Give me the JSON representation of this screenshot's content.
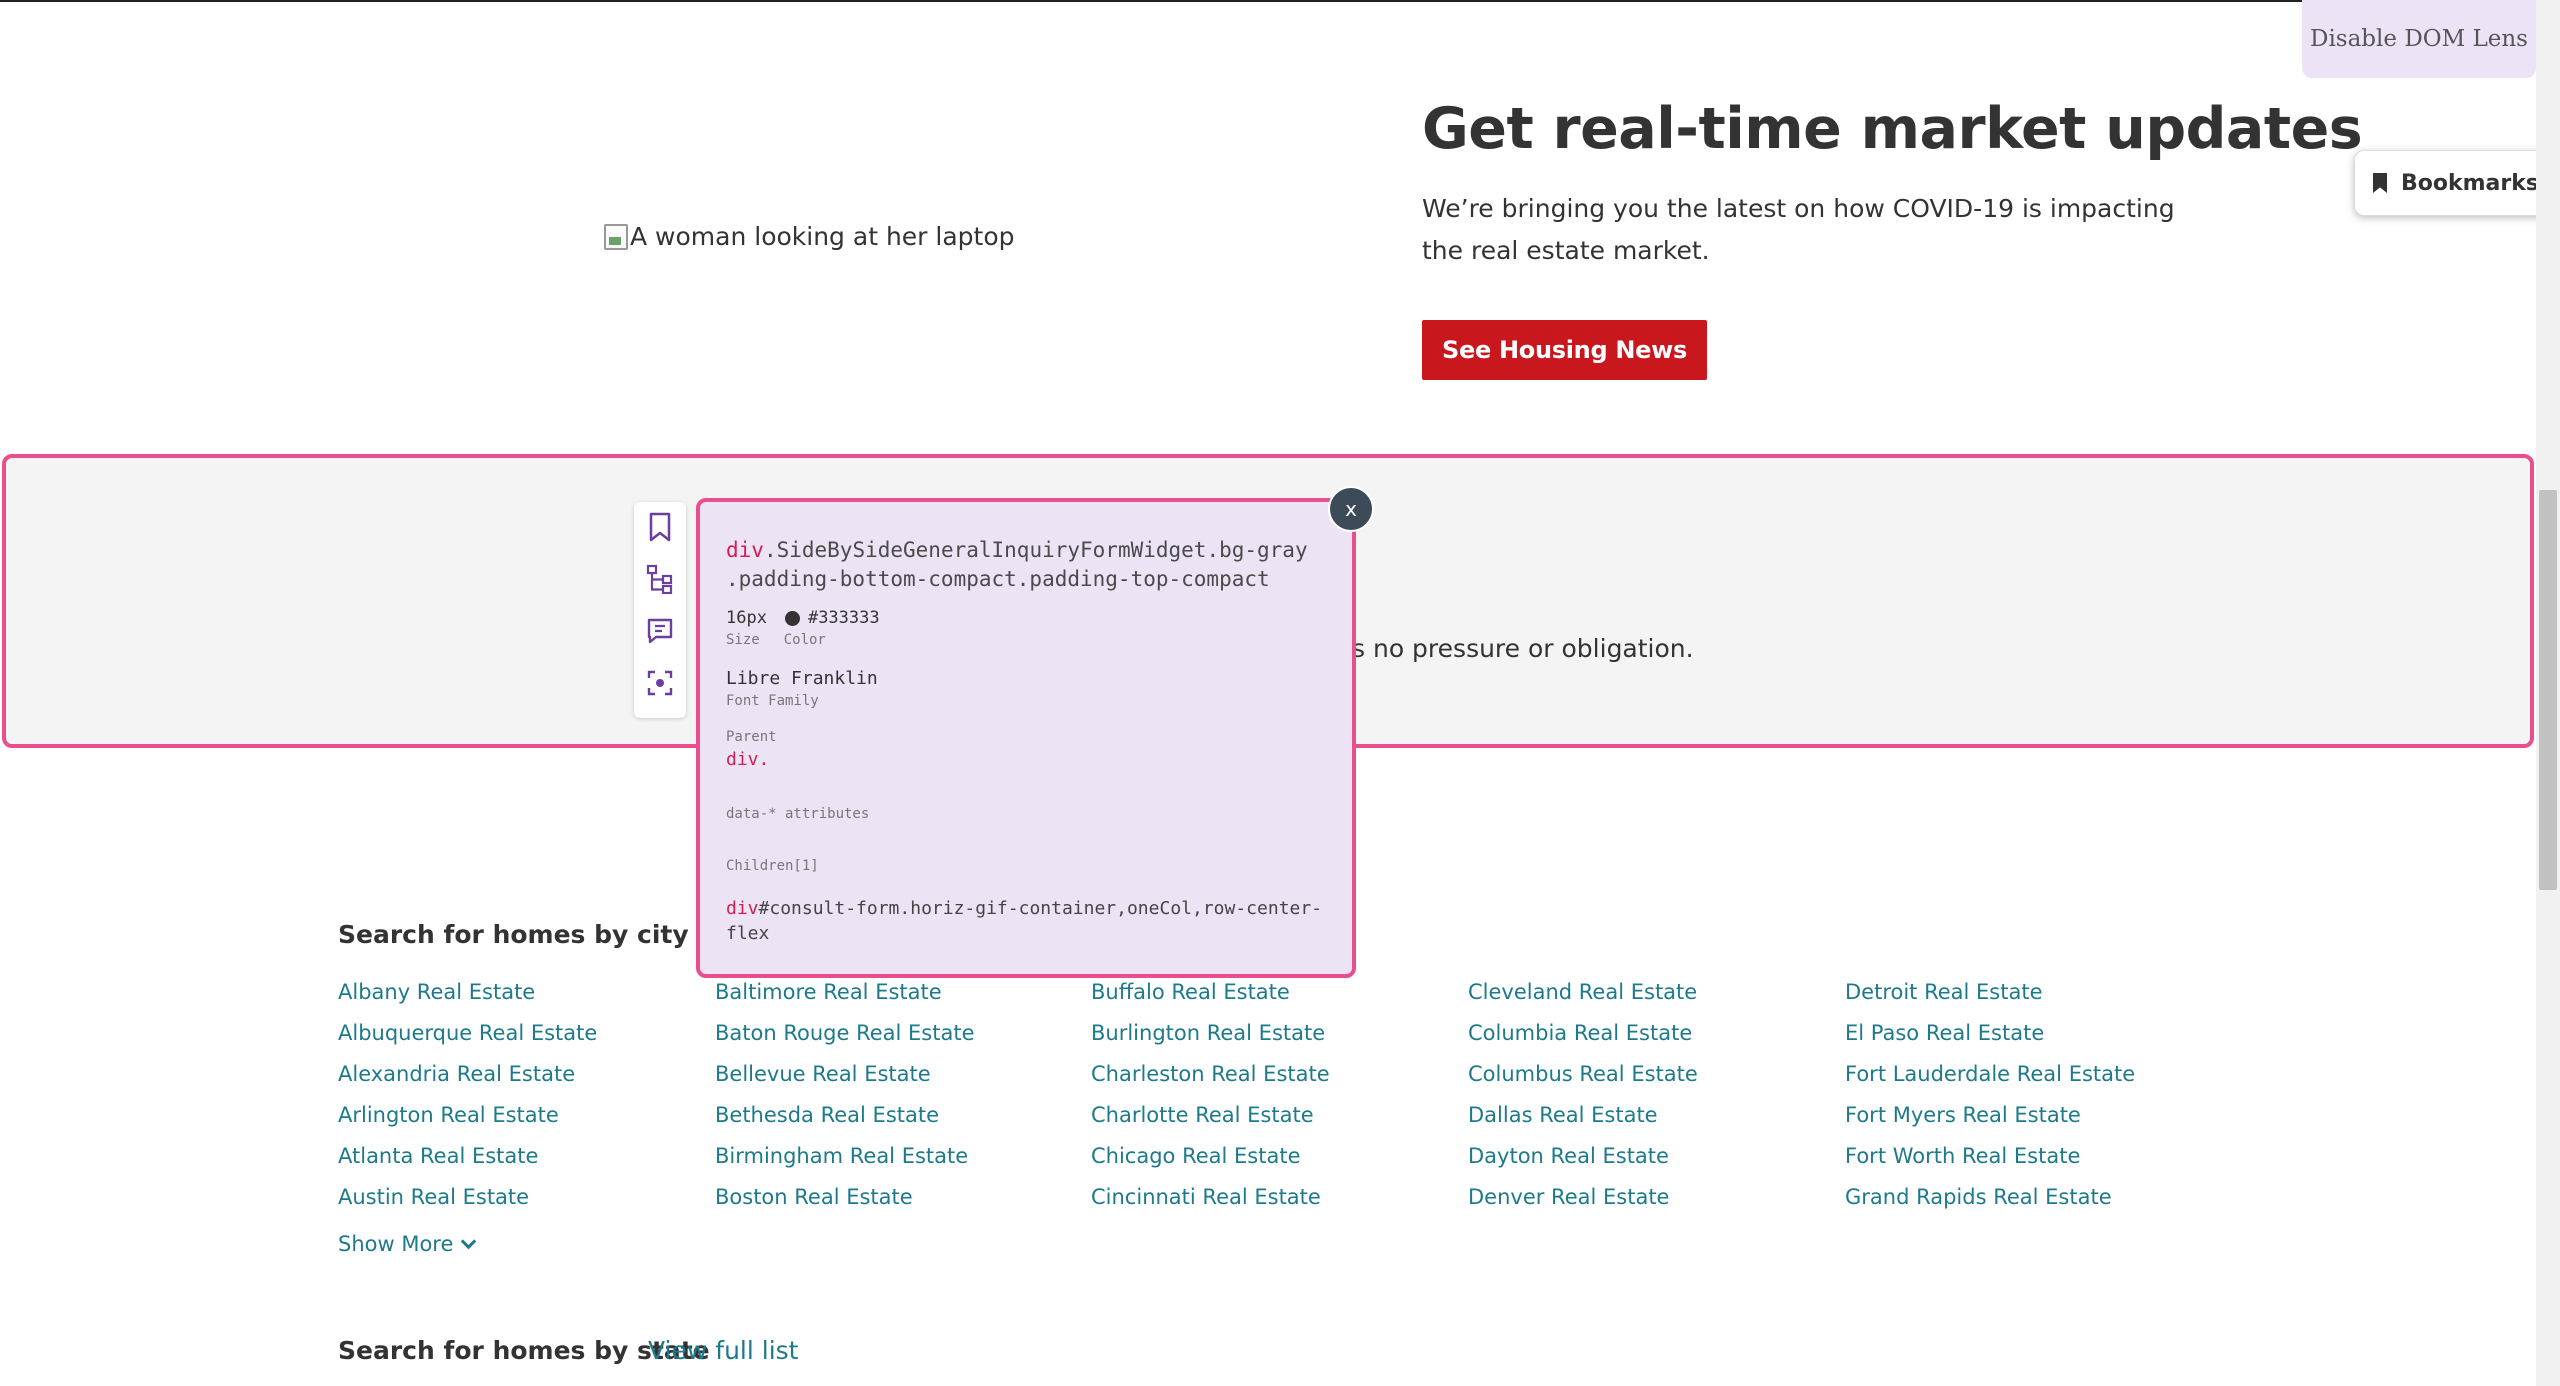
{
  "hero": {
    "image_alt": "A woman looking at her laptop",
    "title": "Get real-time market updates",
    "subtitle": "We’re bringing you the latest on how COVID-19 is impacting the real estate market.",
    "cta_label": "See Housing News"
  },
  "dom_lens": {
    "toggle_label": "Disable DOM Lens",
    "bookmarks_label": "Bookmarks"
  },
  "inquiry": {
    "visible_text": "s no pressure or obligation."
  },
  "inspector": {
    "close_label": "x",
    "selector_tag": "div",
    "selector_line1": ".SideBySideGeneralInquiryFormWidget.bg-gray",
    "selector_line2": ".padding-bottom-compact.padding-top-compact",
    "size_value": "16px",
    "color_value": "#333333",
    "size_caption": "Size",
    "color_caption": "Color",
    "font_family_value": "Libre Franklin",
    "font_family_caption": "Font Family",
    "parent_caption": "Parent",
    "parent_value": "div.",
    "data_attrs_caption": "data-* attributes",
    "children_caption": "Children[1]",
    "child_tag": "div",
    "child_selector": "#consult-form.horiz-gif-container,oneCol,row-center-flex"
  },
  "cities": {
    "heading": "Search for homes by city",
    "columns": [
      [
        "Albany Real Estate",
        "Albuquerque Real Estate",
        "Alexandria Real Estate",
        "Arlington Real Estate",
        "Atlanta Real Estate",
        "Austin Real Estate"
      ],
      [
        "Baltimore Real Estate",
        "Baton Rouge Real Estate",
        "Bellevue Real Estate",
        "Bethesda Real Estate",
        "Birmingham Real Estate",
        "Boston Real Estate"
      ],
      [
        "Buffalo Real Estate",
        "Burlington Real Estate",
        "Charleston Real Estate",
        "Charlotte Real Estate",
        "Chicago Real Estate",
        "Cincinnati Real Estate"
      ],
      [
        "Cleveland Real Estate",
        "Columbia Real Estate",
        "Columbus Real Estate",
        "Dallas Real Estate",
        "Dayton Real Estate",
        "Denver Real Estate"
      ],
      [
        "Detroit Real Estate",
        "El Paso Real Estate",
        "Fort Lauderdale Real Estate",
        "Fort Myers Real Estate",
        "Fort Worth Real Estate",
        "Grand Rapids Real Estate"
      ]
    ],
    "show_more_label": "Show More"
  },
  "states": {
    "heading": "Search for homes by state",
    "view_full_list_label": "View full list"
  },
  "colors": {
    "cta_red": "#c8181e",
    "link_teal": "#1d7a8a",
    "highlight_pink": "#e84f8c",
    "inspector_bg": "#ece4f4"
  }
}
